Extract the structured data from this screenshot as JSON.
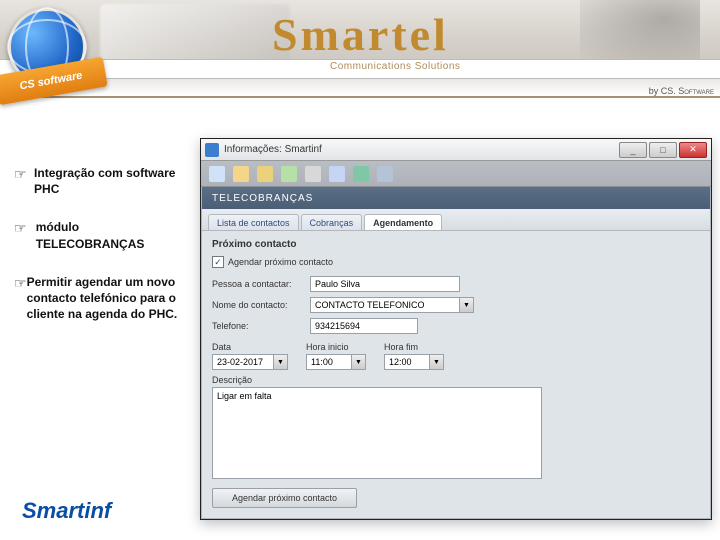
{
  "banner": {
    "brand": "Smartel",
    "tagline": "Communications Solutions",
    "by_prefix": "by",
    "by_company": "CS. Software",
    "ribbon": "CS software"
  },
  "side_points": [
    "Integração com software PHC",
    "módulo TELECOBRANÇAS",
    "Permitir agendar um novo contacto telefónico para o cliente na agenda do PHC."
  ],
  "footer_brand": "Smartinf",
  "window": {
    "title": "Informações: Smartinf",
    "section": "TELECOBRANÇAS",
    "tabs": [
      {
        "label": "Lista de contactos",
        "active": false
      },
      {
        "label": "Cobranças",
        "active": false
      },
      {
        "label": "Agendamento",
        "active": true
      }
    ],
    "form": {
      "title": "Próximo contacto",
      "checkbox_label": "Agendar próximo contacto",
      "checkbox_checked": true,
      "pessoa_label": "Pessoa a contactar:",
      "pessoa_value": "Paulo Silva",
      "nome_label": "Nome do contacto:",
      "nome_value": "CONTACTO TELEFONICO",
      "telefone_label": "Telefone:",
      "telefone_value": "934215694",
      "data_label": "Data",
      "data_value": "23-02-2017",
      "hora_inicio_label": "Hora inicio",
      "hora_inicio_value": "11:00",
      "hora_fim_label": "Hora fim",
      "hora_fim_value": "12:00",
      "descricao_label": "Descrição",
      "descricao_value": "Ligar em falta",
      "submit_label": "Agendar próximo contacto"
    }
  }
}
